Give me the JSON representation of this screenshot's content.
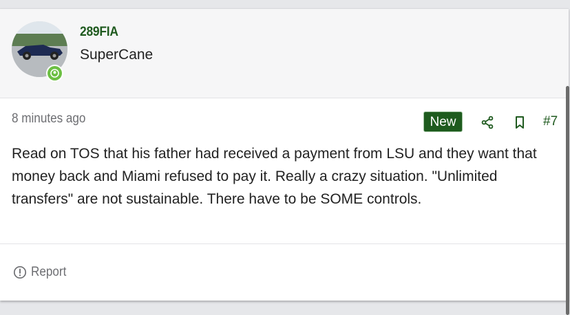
{
  "post": {
    "author": {
      "username": "289FIA",
      "user_title": "SuperCane"
    },
    "time": "8 minutes ago",
    "badge": "New",
    "post_number": "#7",
    "message": "Read on TOS that his father had received a payment from LSU and they want that money back and Miami refused to pay it. Really a crazy situation. \"Unlimited transfers\" are not sustainable. There have to be SOME controls.",
    "actions": {
      "share_icon": "share-icon",
      "bookmark_icon": "bookmark-icon"
    },
    "footer": {
      "report_label": "Report"
    }
  },
  "colors": {
    "brand_green": "#1e5b1e",
    "online_green": "#6cbf43",
    "meta_gray": "#6d6e72"
  }
}
